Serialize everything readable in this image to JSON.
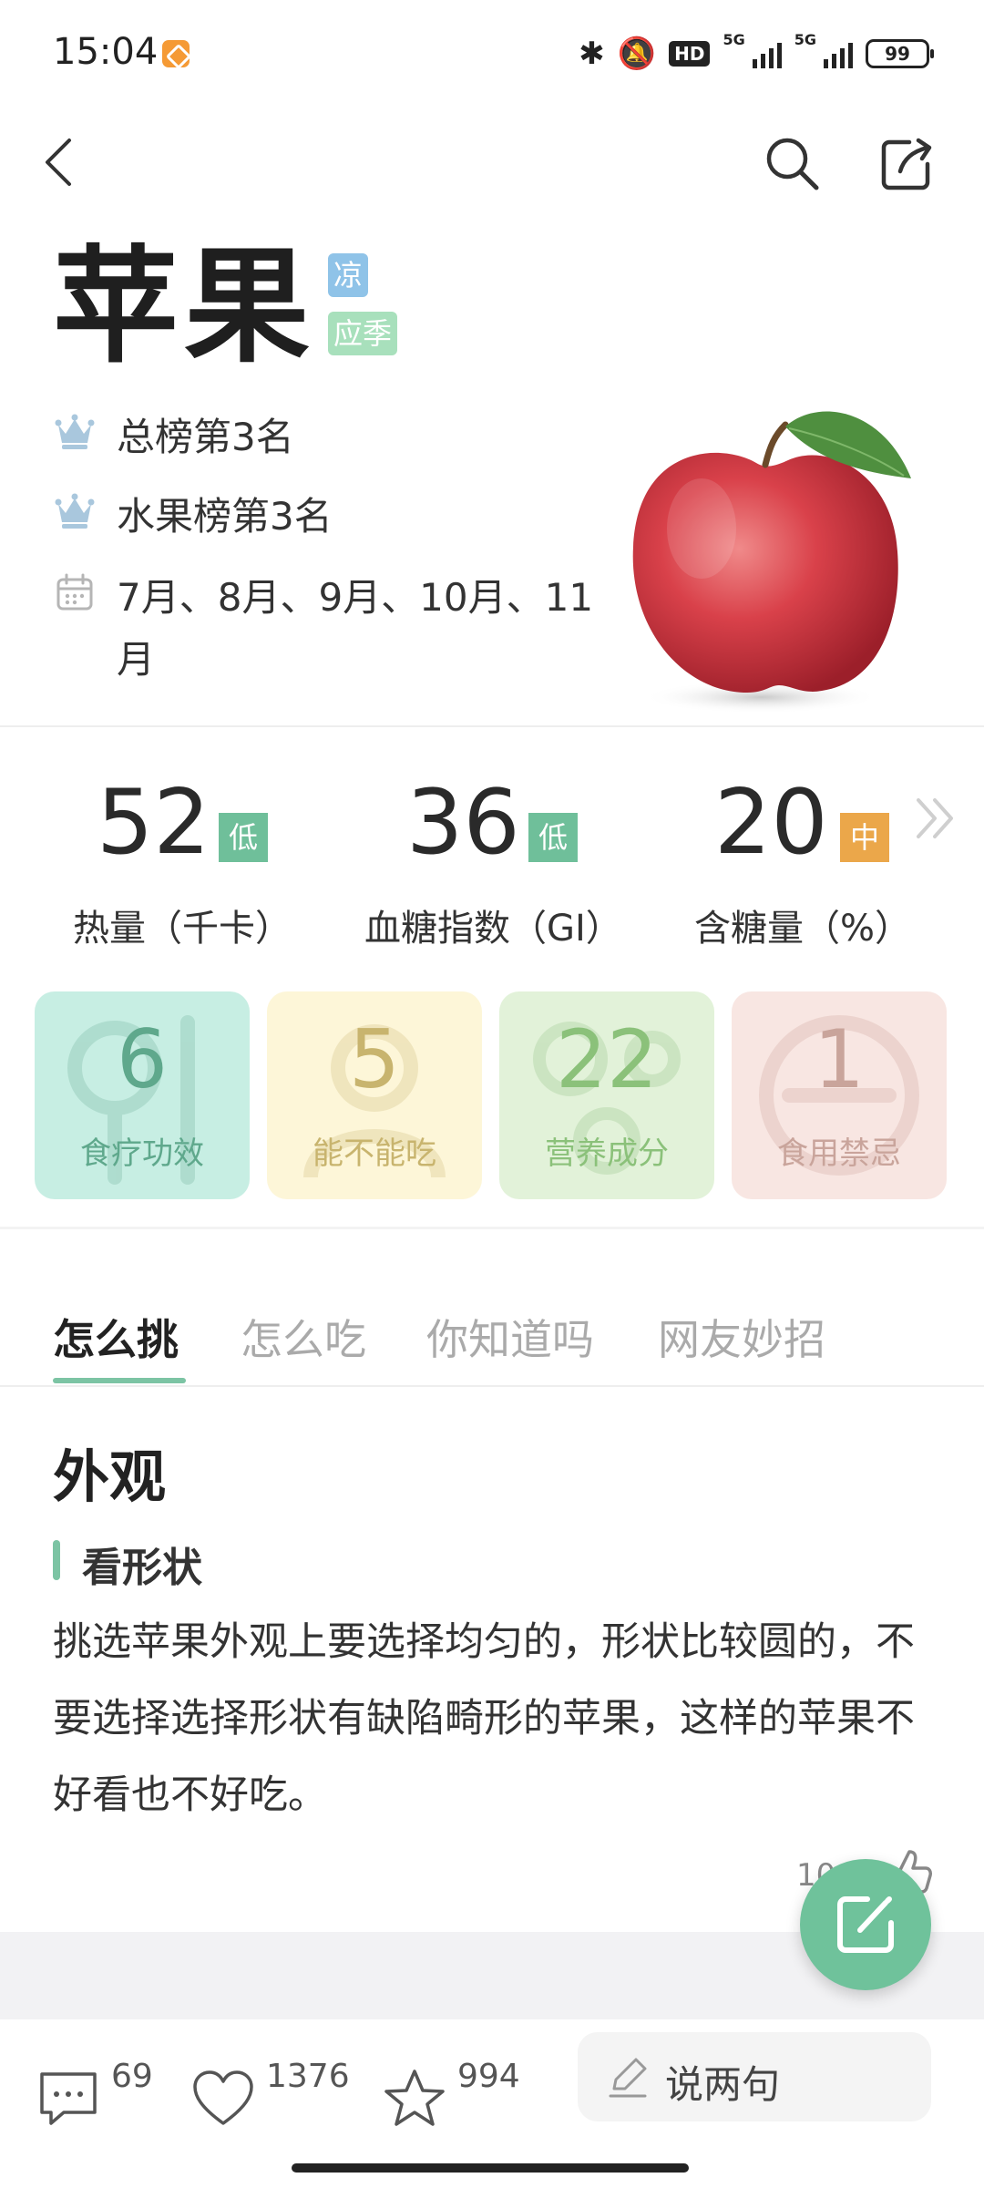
{
  "status_bar": {
    "time": "15:04",
    "battery": "99",
    "network1": "5G",
    "network2": "5G",
    "hd": "HD"
  },
  "header": {
    "title": "苹果",
    "tag_nature": "凉",
    "tag_season": "应季",
    "rank_total": "总榜第3名",
    "rank_fruit": "水果榜第3名",
    "months": "7月、8月、9月、10月、11月"
  },
  "stats": [
    {
      "value": "52",
      "level": "低",
      "label": "热量（千卡）",
      "color": "#6fbf9a"
    },
    {
      "value": "36",
      "level": "低",
      "label": "血糖指数（GI）",
      "color": "#6fbf9a"
    },
    {
      "value": "20",
      "level": "中",
      "label": "含糖量（%）",
      "color": "#eba74a"
    }
  ],
  "cards": [
    {
      "count": "6",
      "label": "食疗功效",
      "bg": "#c7eee3",
      "fg": "#5fa88c"
    },
    {
      "count": "5",
      "label": "能不能吃",
      "bg": "#fdf6d8",
      "fg": "#c8b46e"
    },
    {
      "count": "22",
      "label": "营养成分",
      "bg": "#e2f2d9",
      "fg": "#8bc17a"
    },
    {
      "count": "1",
      "label": "食用禁忌",
      "bg": "#f8e6e2",
      "fg": "#c9a49b"
    }
  ],
  "tabs": [
    "怎么挑",
    "怎么吃",
    "你知道吗",
    "网友妙招"
  ],
  "article": {
    "section_title": "外观",
    "subheading": "看形状",
    "body": "挑选苹果外观上要选择均匀的，形状比较圆的，不要选择选择形状有缺陷畸形的苹果，这样的苹果不好看也不好吃。",
    "like_count": "10"
  },
  "bottom_bar": {
    "comments": "69",
    "likes": "1376",
    "favorites": "994",
    "comment_placeholder": "说两句"
  },
  "colors": {
    "accent": "#7cc4a4",
    "fab": "#6fc29b"
  },
  "icons": [
    "back-arrow-icon",
    "search-icon",
    "share-icon",
    "crown-icon",
    "calendar-icon",
    "chevron-right-icon",
    "like-icon",
    "edit-icon",
    "comment-icon",
    "heart-icon",
    "star-icon",
    "pencil-icon"
  ]
}
